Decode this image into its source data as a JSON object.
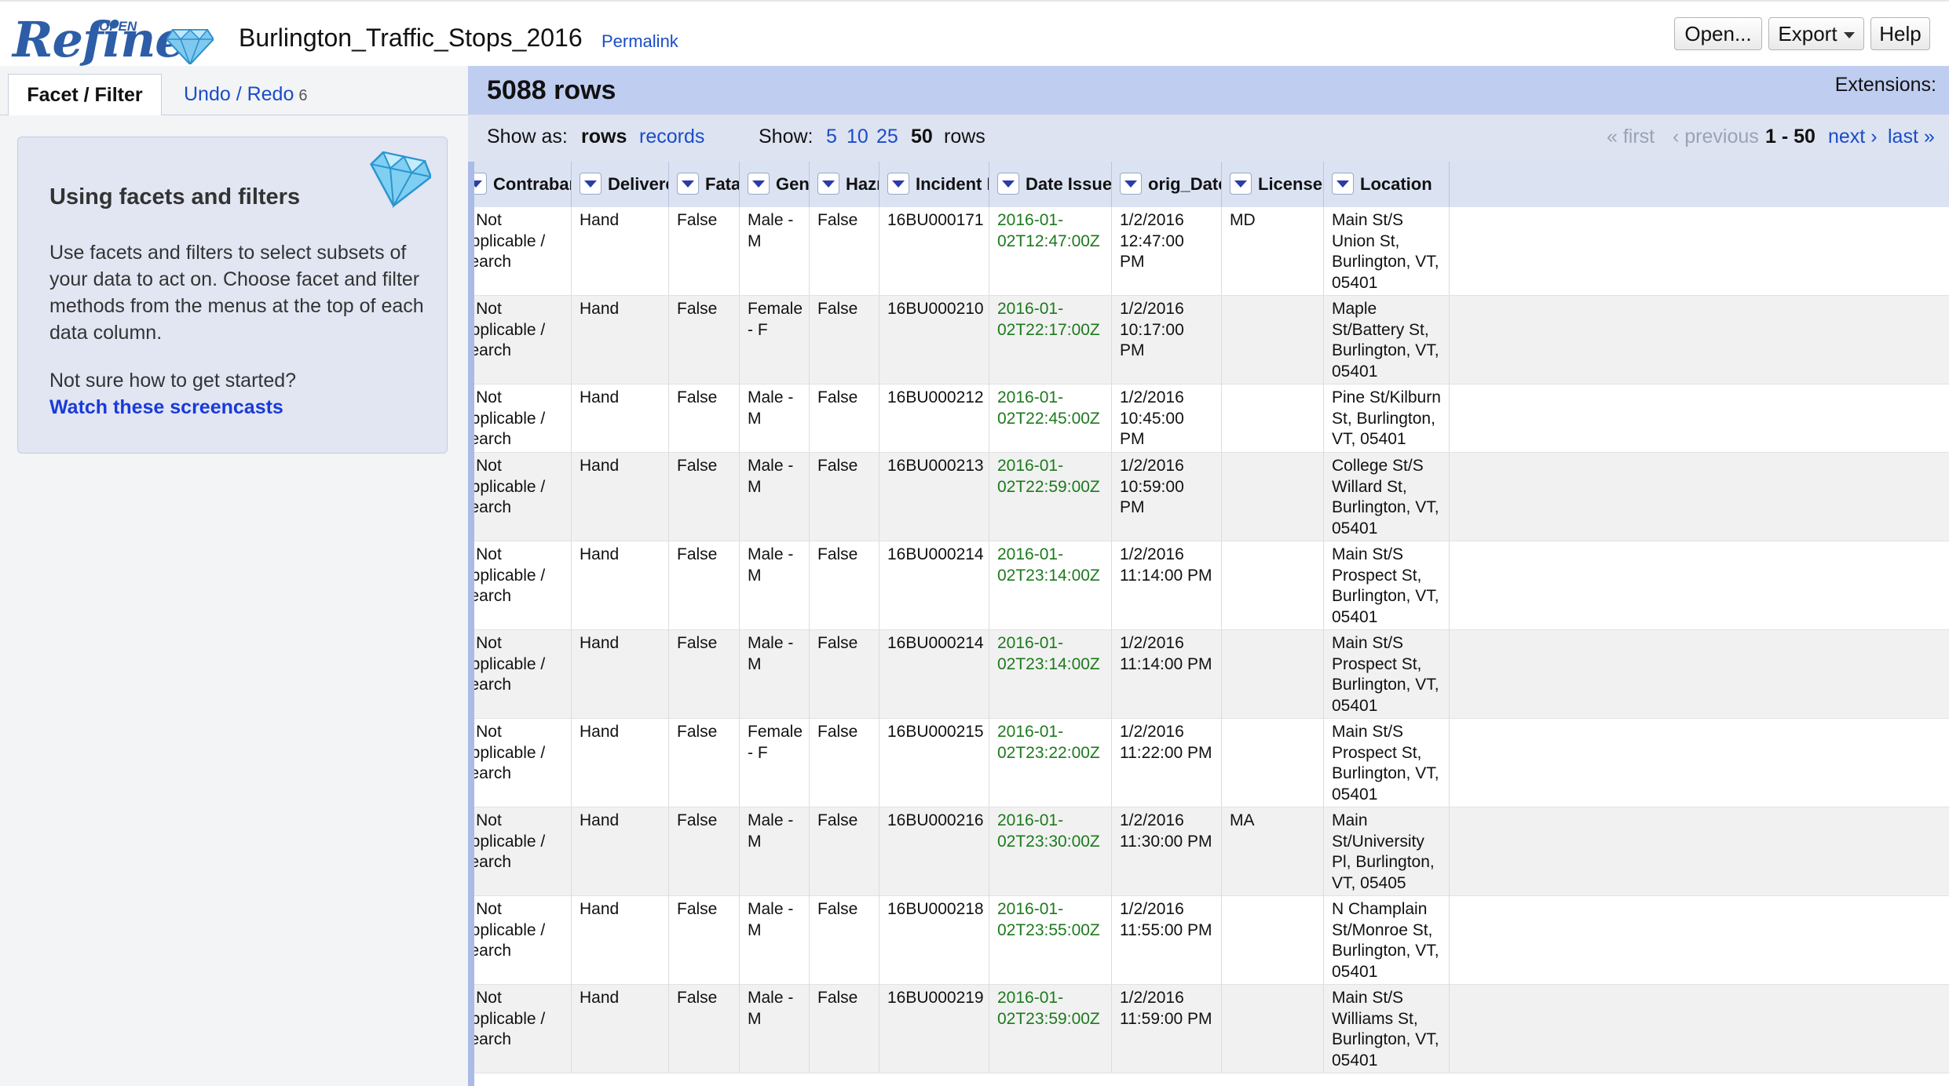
{
  "app": {
    "logo_text": "Refine",
    "logo_open": "OPEN",
    "project_name": "Burlington_Traffic_Stops_2016",
    "permalink": "Permalink",
    "buttons": {
      "open": "Open...",
      "export": "Export",
      "help": "Help"
    }
  },
  "left_panel": {
    "tabs": {
      "facet": "Facet / Filter",
      "undo": "Undo / Redo",
      "undo_count": "6"
    },
    "help": {
      "title": "Using facets and filters",
      "text": "Use facets and filters to select subsets of your data to act on. Choose facet and filter methods from the menus at the top of each data column.",
      "unsure": "Not sure how to get started?",
      "link": "Watch these screencasts"
    }
  },
  "summary": {
    "row_count": "5088 rows",
    "extensions": "Extensions:"
  },
  "view_bar": {
    "show_as_label": "Show as:",
    "rows": "rows",
    "records": "records",
    "show_label": "Show:",
    "sizes": [
      "5",
      "10",
      "25",
      "50"
    ],
    "rows_suffix": "rows",
    "first": "« first",
    "previous": "‹ previous",
    "range": "1 - 50",
    "next": "next ›",
    "last": "last »"
  },
  "columns": [
    "Contraband Evidence",
    "Delivered By",
    "Fatality",
    "Gender",
    "Hazmat",
    "Incident Number",
    "Date Issued",
    "orig_Date_Issued",
    "License State",
    "Location"
  ],
  "rows": [
    {
      "contraband": "= Not applicable / search",
      "delivered": "Hand",
      "fatality": "False",
      "gender": "Male - M",
      "hazmat": "False",
      "incident": "16BU000171",
      "date": "2016-01-02T12:47:00Z",
      "orig": "1/2/2016 12:47:00 PM",
      "state": "MD",
      "location": "Main St/S Union St, Burlington, VT, 05401"
    },
    {
      "contraband": "= Not applicable / search",
      "delivered": "Hand",
      "fatality": "False",
      "gender": "Female - F",
      "hazmat": "False",
      "incident": "16BU000210",
      "date": "2016-01-02T22:17:00Z",
      "orig": "1/2/2016 10:17:00 PM",
      "state": "",
      "location": "Maple St/Battery St, Burlington, VT, 05401"
    },
    {
      "contraband": "= Not applicable / search",
      "delivered": "Hand",
      "fatality": "False",
      "gender": "Male - M",
      "hazmat": "False",
      "incident": "16BU000212",
      "date": "2016-01-02T22:45:00Z",
      "orig": "1/2/2016 10:45:00 PM",
      "state": "",
      "location": "Pine St/Kilburn St, Burlington, VT, 05401"
    },
    {
      "contraband": "= Not applicable / search",
      "delivered": "Hand",
      "fatality": "False",
      "gender": "Male - M",
      "hazmat": "False",
      "incident": "16BU000213",
      "date": "2016-01-02T22:59:00Z",
      "orig": "1/2/2016 10:59:00 PM",
      "state": "",
      "location": "College St/S Willard St, Burlington, VT, 05401"
    },
    {
      "contraband": "= Not applicable / search",
      "delivered": "Hand",
      "fatality": "False",
      "gender": "Male - M",
      "hazmat": "False",
      "incident": "16BU000214",
      "date": "2016-01-02T23:14:00Z",
      "orig": "1/2/2016 11:14:00 PM",
      "state": "",
      "location": "Main St/S Prospect St, Burlington, VT, 05401"
    },
    {
      "contraband": "= Not applicable / search",
      "delivered": "Hand",
      "fatality": "False",
      "gender": "Male - M",
      "hazmat": "False",
      "incident": "16BU000214",
      "date": "2016-01-02T23:14:00Z",
      "orig": "1/2/2016 11:14:00 PM",
      "state": "",
      "location": "Main St/S Prospect St, Burlington, VT, 05401"
    },
    {
      "contraband": "= Not applicable / search",
      "delivered": "Hand",
      "fatality": "False",
      "gender": "Female - F",
      "hazmat": "False",
      "incident": "16BU000215",
      "date": "2016-01-02T23:22:00Z",
      "orig": "1/2/2016 11:22:00 PM",
      "state": "",
      "location": "Main St/S Prospect St, Burlington, VT, 05401"
    },
    {
      "contraband": "= Not applicable / search",
      "delivered": "Hand",
      "fatality": "False",
      "gender": "Male - M",
      "hazmat": "False",
      "incident": "16BU000216",
      "date": "2016-01-02T23:30:00Z",
      "orig": "1/2/2016 11:30:00 PM",
      "state": "MA",
      "location": "Main St/University Pl, Burlington, VT, 05405"
    },
    {
      "contraband": "= Not applicable / search",
      "delivered": "Hand",
      "fatality": "False",
      "gender": "Male - M",
      "hazmat": "False",
      "incident": "16BU000218",
      "date": "2016-01-02T23:55:00Z",
      "orig": "1/2/2016 11:55:00 PM",
      "state": "",
      "location": "N Champlain St/Monroe St, Burlington, VT, 05401"
    },
    {
      "contraband": "= Not applicable / search",
      "delivered": "Hand",
      "fatality": "False",
      "gender": "Male - M",
      "hazmat": "False",
      "incident": "16BU000219",
      "date": "2016-01-02T23:59:00Z",
      "orig": "1/2/2016 11:59:00 PM",
      "state": "",
      "location": "Main St/S Williams St, Burlington, VT, 05401"
    }
  ]
}
